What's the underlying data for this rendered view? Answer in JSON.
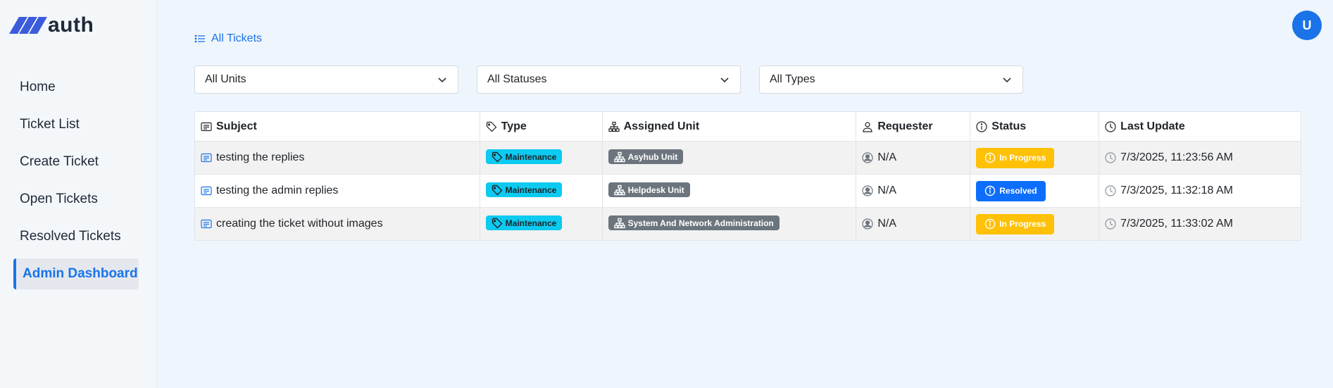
{
  "app": {
    "logo_text": "auth",
    "user_initial": "U"
  },
  "sidebar": {
    "items": [
      {
        "label": "Home"
      },
      {
        "label": "Ticket List"
      },
      {
        "label": "Create Ticket"
      },
      {
        "label": "Open Tickets"
      },
      {
        "label": "Resolved Tickets"
      },
      {
        "label": "Admin Dashboard",
        "active": true
      }
    ]
  },
  "breadcrumb": {
    "label": "All Tickets"
  },
  "filters": {
    "units": "All Units",
    "statuses": "All Statuses",
    "types": "All Types"
  },
  "table": {
    "headers": {
      "subject": "Subject",
      "type": "Type",
      "unit": "Assigned Unit",
      "requester": "Requester",
      "status": "Status",
      "updated": "Last Update"
    },
    "rows": [
      {
        "subject": "testing the replies",
        "type": "Maintenance",
        "unit": "Asyhub Unit",
        "requester": "N/A",
        "status": "In Progress",
        "updated": "7/3/2025, 11:23:56 AM"
      },
      {
        "subject": "testing the admin replies",
        "type": "Maintenance",
        "unit": "Helpdesk Unit",
        "requester": "N/A",
        "status": "Resolved",
        "updated": "7/3/2025, 11:32:18 AM"
      },
      {
        "subject": "creating the ticket without images",
        "type": "Maintenance",
        "unit": "System And Network Administration",
        "requester": "N/A",
        "status": "In Progress",
        "updated": "7/3/2025, 11:33:02 AM"
      }
    ]
  },
  "colors": {
    "accent": "#1a73e8",
    "in_progress": "#ffc107",
    "resolved": "#0d6efd",
    "type_badge": "#0dcaf0",
    "unit_badge": "#6c757d"
  },
  "icons": [
    "list-icon",
    "chevron-down-icon",
    "card-text-icon",
    "tag-icon",
    "diagram-icon",
    "person-icon",
    "info-icon",
    "clock-icon",
    "person-circle-icon"
  ]
}
